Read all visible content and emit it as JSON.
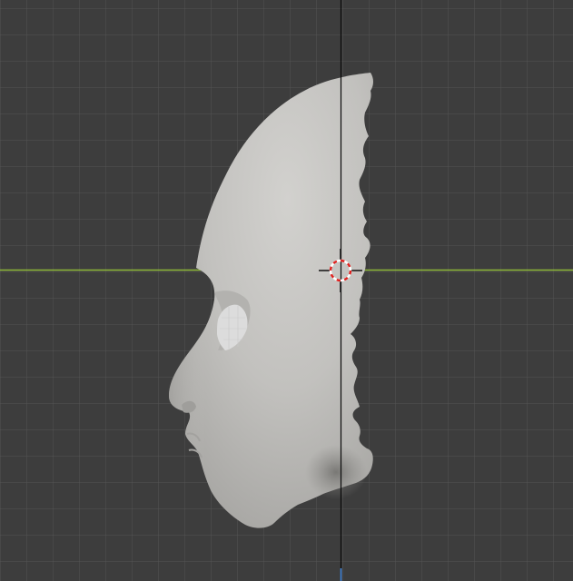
{
  "viewport": {
    "background_color": "#3d3d3d",
    "minor_grid_color": "#474747",
    "major_grid_color": "#545454",
    "x_axis_color": "#8fb93a",
    "z_axis_color": "#0a0a0a",
    "y_axis_stub_color": "#3f82d6",
    "mesh_color": "#c4c3c0",
    "eye_color": "#dcdcdc"
  },
  "scene": {
    "object_icon": "head-mesh-icon",
    "cursor_icon": "3d-cursor-icon"
  }
}
